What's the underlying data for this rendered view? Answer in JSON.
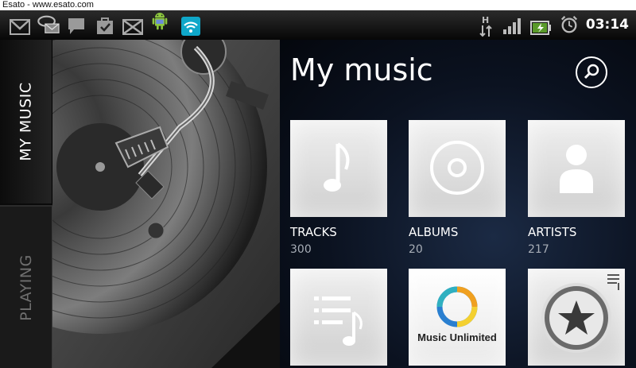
{
  "watermark": "Esato - www.esato.com",
  "status_bar": {
    "notification_icons": [
      "gmail-icon",
      "message-icon",
      "chat-icon",
      "task-icon",
      "email-icon",
      "android-icon",
      "wifi-icon"
    ],
    "system_icons": [
      "hsdpa-icon",
      "signal-icon",
      "battery-icon",
      "alarm-icon"
    ],
    "network_label": "H",
    "time": "03:14"
  },
  "tabs": {
    "my_music": "MY MUSIC",
    "playing": "PLAYING"
  },
  "header": {
    "title": "My music"
  },
  "tiles": [
    {
      "label": "TRACKS",
      "count": "300",
      "icon": "music-note-icon"
    },
    {
      "label": "ALBUMS",
      "count": "20",
      "icon": "disc-icon"
    },
    {
      "label": "ARTISTS",
      "count": "217",
      "icon": "person-icon"
    },
    {
      "label": "",
      "count": "",
      "icon": "playlist-icon"
    },
    {
      "label": "",
      "count": "",
      "icon": "music-unlimited-logo",
      "logo_text": "Music Unlimited"
    },
    {
      "label": "",
      "count": "",
      "icon": "star-icon"
    }
  ],
  "colors": {
    "background": "#0b1220",
    "tile": "#e6e6e6",
    "text": "#ffffff",
    "count_text": "#a7adb6"
  }
}
